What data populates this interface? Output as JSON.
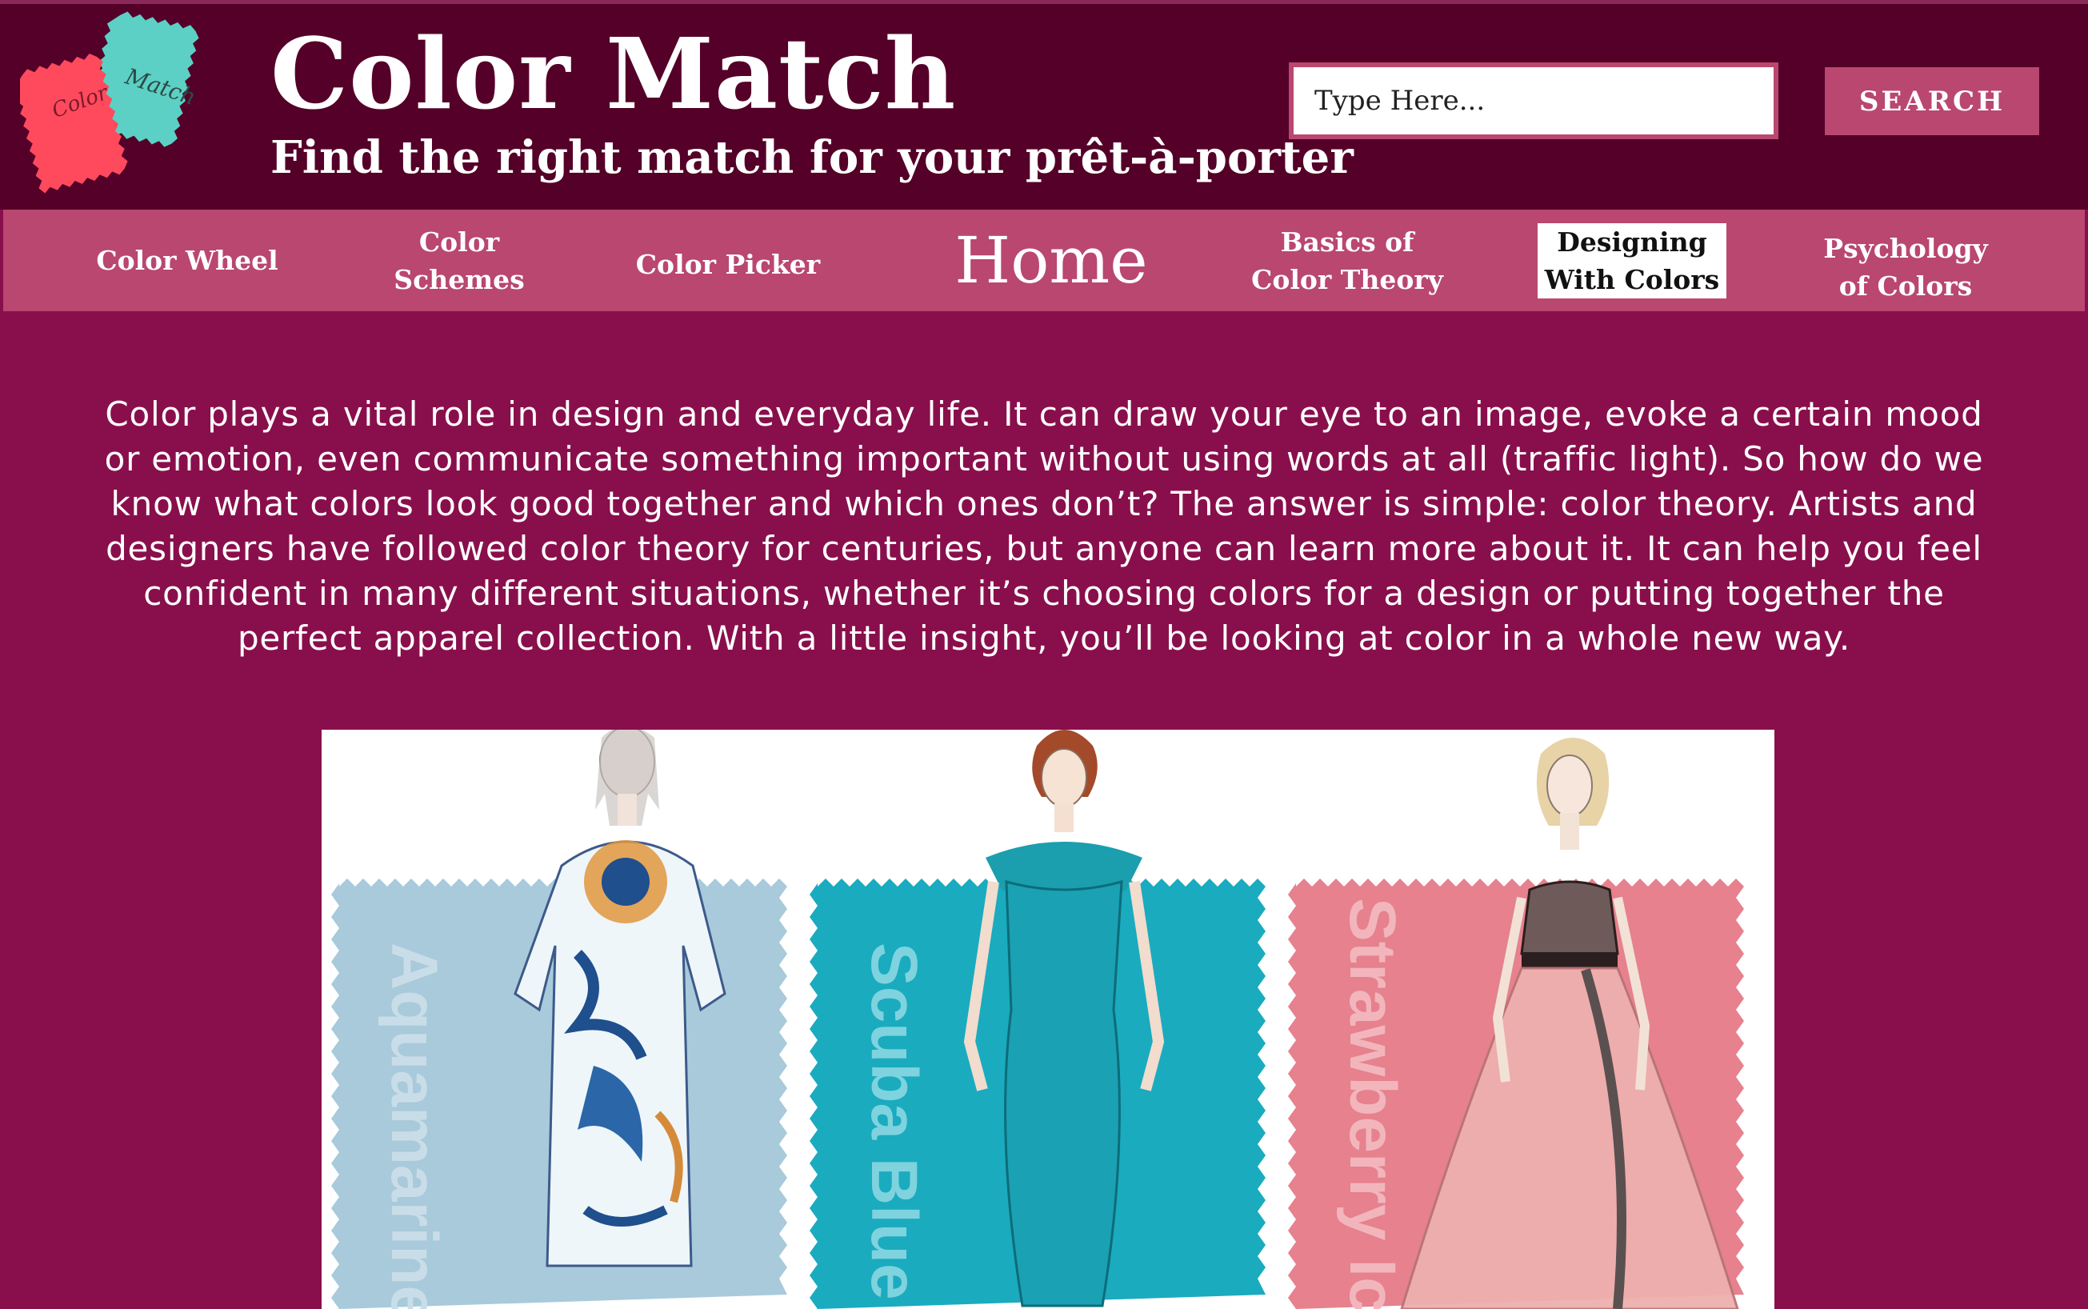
{
  "header": {
    "title": "Color Match",
    "subtitle": "Find the right match for your prêt-à-porter",
    "logo": {
      "words": [
        "Color",
        "Match"
      ],
      "colors": [
        "#ff4a5e",
        "#5cd0c4"
      ]
    },
    "search": {
      "placeholder": "Type Here...",
      "button_label": "SEARCH"
    }
  },
  "nav": {
    "items": [
      {
        "label": "Color Wheel"
      },
      {
        "label": "Color\nSchemes"
      },
      {
        "label": "Color Picker"
      },
      {
        "label": "Home"
      },
      {
        "label": "Basics of\nColor Theory"
      },
      {
        "label": "Designing\nWith Colors",
        "active": true
      },
      {
        "label": "Psychology\nof Colors"
      }
    ]
  },
  "intro": {
    "text": "Color plays a vital role in design and everyday life. It can draw your eye to an image, evoke a certain mood or emotion, even communicate something important without using words at all (traffic light). So how do we know what colors look good together and which ones don’t? The answer is simple: color theory. Artists and designers have followed color theory for centuries, but anyone can learn more about it. It can help you feel confident in many different situations, whether it’s choosing colors for a design or putting together the perfect apparel collection. With a little insight, you’ll be looking at color in a whole new way."
  },
  "hero": {
    "swatches": [
      {
        "name": "Aquamarine",
        "color": "#a8cadb"
      },
      {
        "name": "Scuba Blue",
        "color": "#1aabbf"
      },
      {
        "name": "Strawberry Ice",
        "color": "#e6818d"
      }
    ]
  },
  "colors": {
    "header_bg": "#540028",
    "nav_bg": "#b9476f",
    "page_bg": "#890f4c"
  }
}
